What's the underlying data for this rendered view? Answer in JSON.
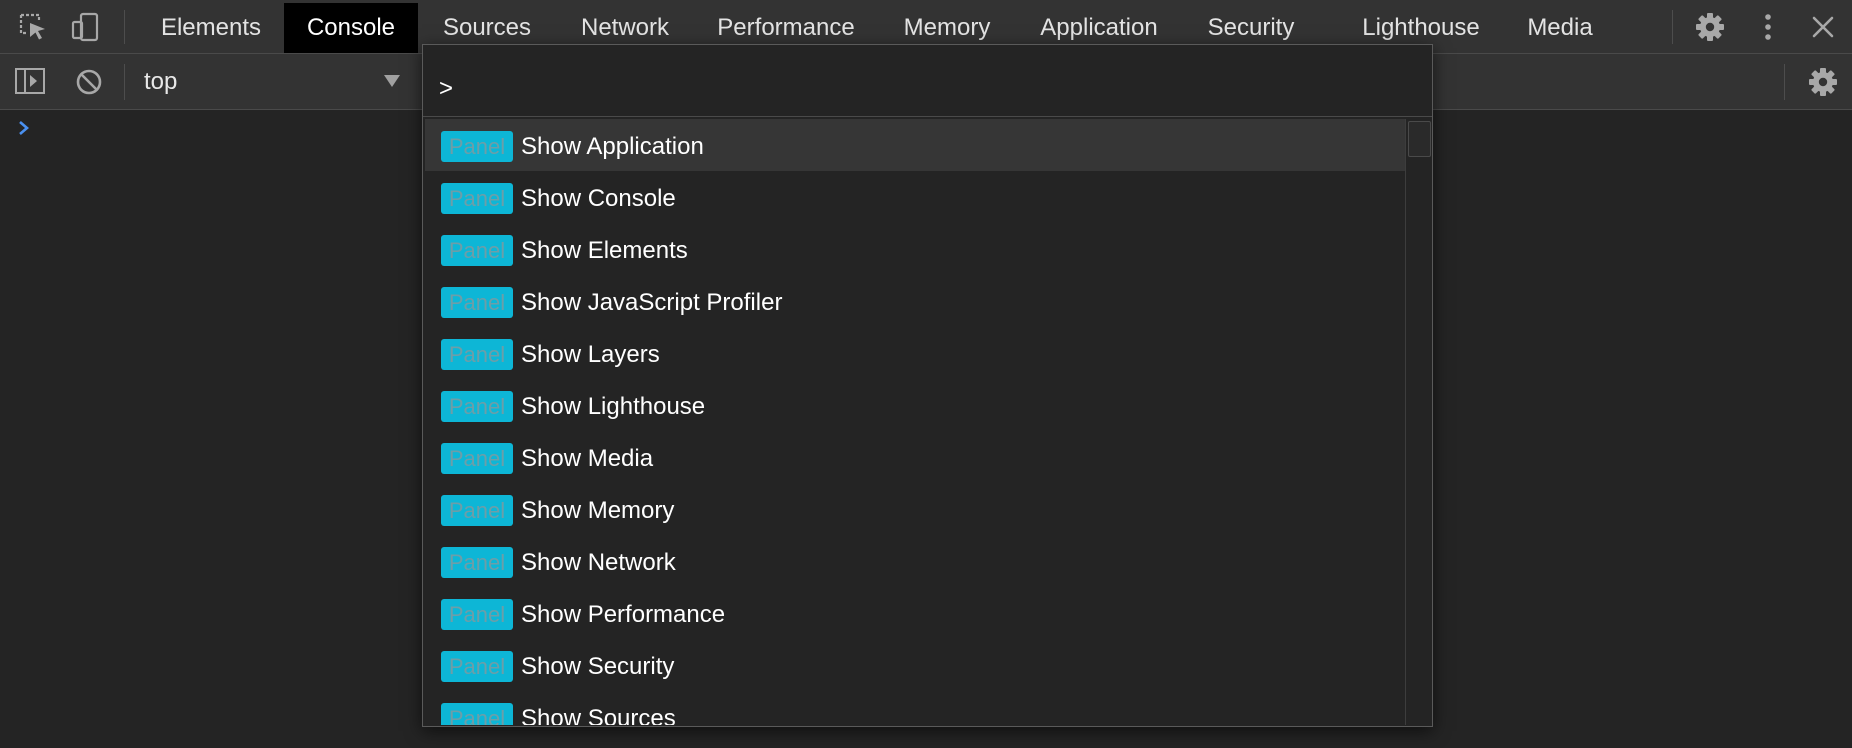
{
  "tabs": [
    {
      "label": "Elements",
      "active": false
    },
    {
      "label": "Console",
      "active": true
    },
    {
      "label": "Sources",
      "active": false
    },
    {
      "label": "Network",
      "active": false
    },
    {
      "label": "Performance",
      "active": false
    },
    {
      "label": "Memory",
      "active": false
    },
    {
      "label": "Application",
      "active": false
    },
    {
      "label": "Security",
      "active": false
    },
    {
      "label": "Lighthouse",
      "active": false
    },
    {
      "label": "Media",
      "active": false
    }
  ],
  "toolbar": {
    "context": "top"
  },
  "command_menu": {
    "prompt": ">",
    "query": "",
    "items": [
      {
        "badge": "Panel",
        "label": "Show Application"
      },
      {
        "badge": "Panel",
        "label": "Show Console"
      },
      {
        "badge": "Panel",
        "label": "Show Elements"
      },
      {
        "badge": "Panel",
        "label": "Show JavaScript Profiler"
      },
      {
        "badge": "Panel",
        "label": "Show Layers"
      },
      {
        "badge": "Panel",
        "label": "Show Lighthouse"
      },
      {
        "badge": "Panel",
        "label": "Show Media"
      },
      {
        "badge": "Panel",
        "label": "Show Memory"
      },
      {
        "badge": "Panel",
        "label": "Show Network"
      },
      {
        "badge": "Panel",
        "label": "Show Performance"
      },
      {
        "badge": "Panel",
        "label": "Show Security"
      },
      {
        "badge": "Panel",
        "label": "Show Sources"
      }
    ]
  },
  "icons": {
    "inspect": "inspect-element-icon",
    "device": "device-toolbar-icon",
    "settings": "gear-icon",
    "more": "more-vertical-icon",
    "close": "close-icon",
    "sidebar": "show-sidebar-icon",
    "clear": "clear-console-icon",
    "console_settings": "console-settings-icon"
  },
  "colors": {
    "badge_bg": "#0db6d6",
    "badge_text": "#6d9ea8",
    "active_tab_bg": "#000000",
    "prompt_chevron": "#4a90f0"
  }
}
